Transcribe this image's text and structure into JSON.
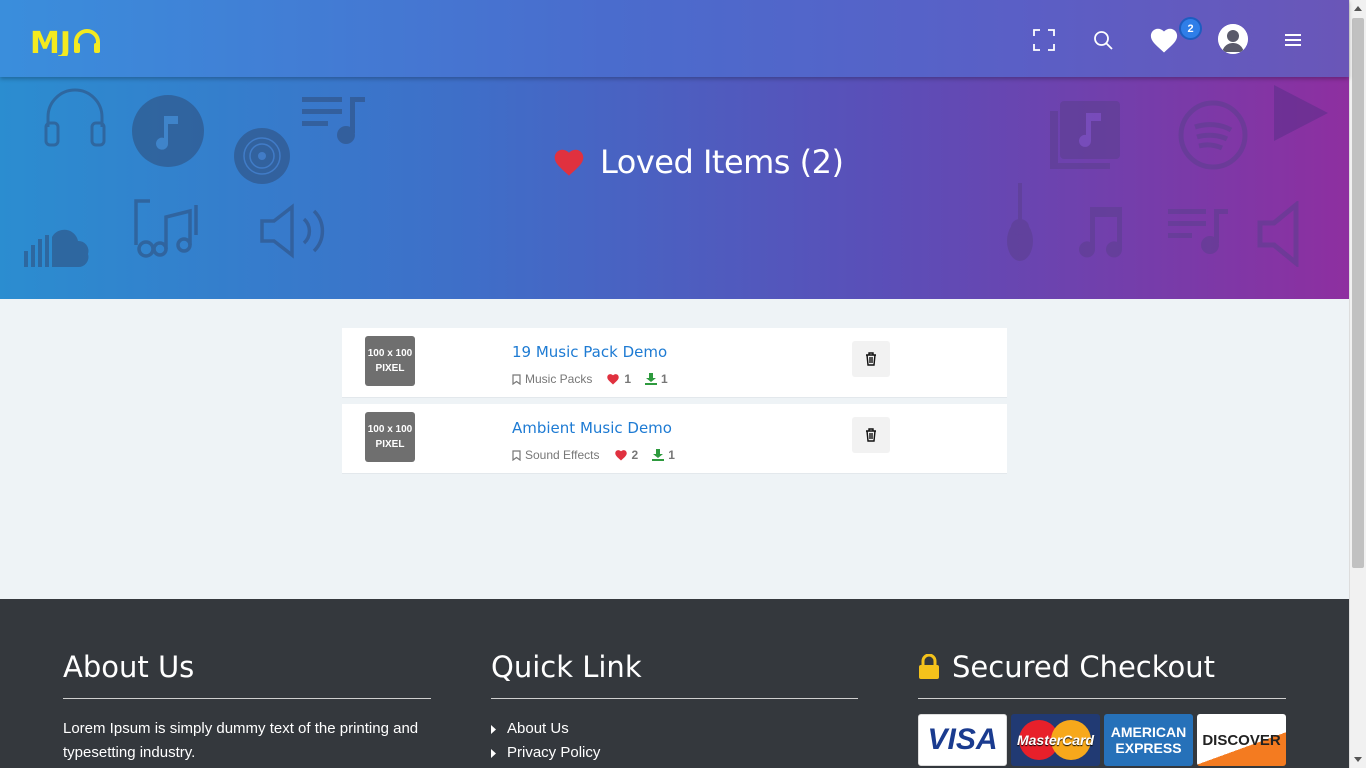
{
  "header": {
    "logo_text": "MJ",
    "icons": [
      "fullscreen-icon",
      "search-icon",
      "heart-icon",
      "user-avatar-icon",
      "menu-icon"
    ],
    "loved_count": "2"
  },
  "hero": {
    "title": "Loved Items (2)"
  },
  "items": [
    {
      "thumb_line1": "100 x 100",
      "thumb_line2": "PIXEL",
      "title": "19 Music Pack Demo",
      "category": "Music Packs",
      "likes": "1",
      "downloads": "1"
    },
    {
      "thumb_line1": "100 x 100",
      "thumb_line2": "PIXEL",
      "title": "Ambient Music Demo",
      "category": "Sound Effects",
      "likes": "2",
      "downloads": "1"
    }
  ],
  "footer": {
    "about": {
      "title": "About Us",
      "text": "Lorem Ipsum is simply dummy text of the printing and typesetting industry."
    },
    "quick": {
      "title": "Quick Link",
      "links": [
        "About Us",
        "Privacy Policy"
      ]
    },
    "secure": {
      "title": "Secured Checkout",
      "cards": [
        "VISA",
        "MasterCard",
        "AMERICAN EXPRESS",
        "DISCOVER"
      ]
    }
  },
  "colors": {
    "accent": "#1e7bd3",
    "heart": "#e0313f",
    "download": "#2e9a3e",
    "footer_bg": "#34383d",
    "logo": "#f4ea1f"
  }
}
